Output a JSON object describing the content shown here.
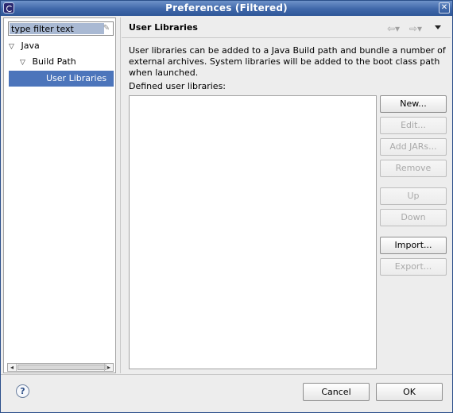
{
  "window": {
    "title": "Preferences (Filtered)"
  },
  "filter": {
    "placeholder": "type filter text"
  },
  "tree": {
    "java": "Java",
    "build_path": "Build Path",
    "user_libraries": "User Libraries"
  },
  "page": {
    "title": "User Libraries",
    "description": "User libraries can be added to a Java Build path and bundle a number of external archives. System libraries will be added to the boot class path when launched.",
    "defined_label": "Defined user libraries:"
  },
  "buttons": {
    "new": "New...",
    "edit": "Edit...",
    "add_jars": "Add JARs...",
    "remove": "Remove",
    "up": "Up",
    "down": "Down",
    "import": "Import...",
    "export": "Export..."
  },
  "footer": {
    "cancel": "Cancel",
    "ok": "OK"
  },
  "icons": {
    "help": "?",
    "close": "✕",
    "back": "⇦▾",
    "forward": "⇨▾"
  },
  "colors": {
    "selection": "#4c75bb",
    "title_bar": "#3f67a9"
  }
}
